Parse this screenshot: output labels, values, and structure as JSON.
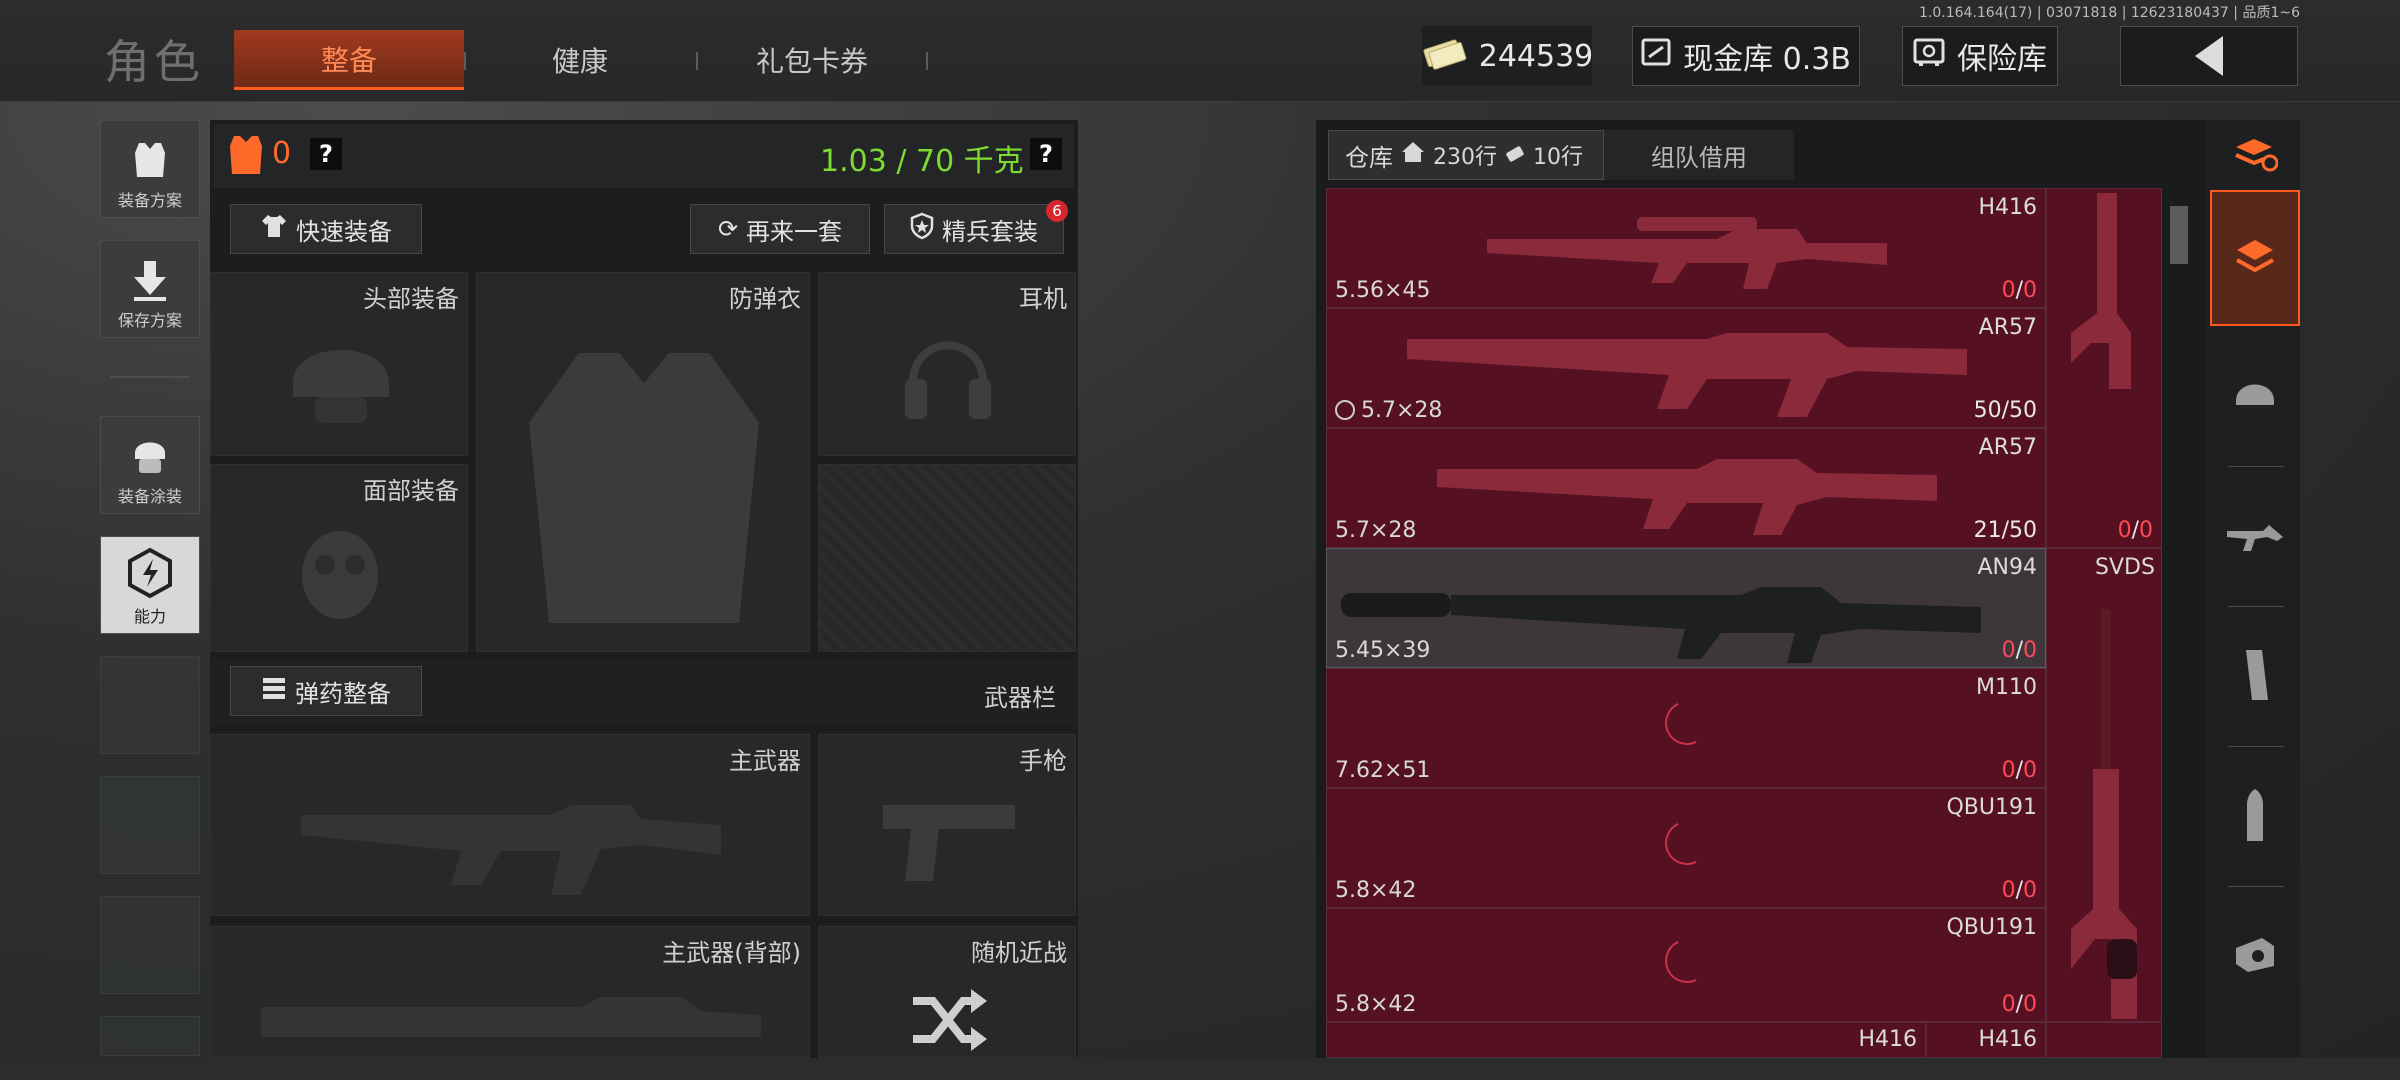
{
  "version": "1.0.164.164(17) | 03071818 | 12623180437 | 品质1~6",
  "header": {
    "title": "角色",
    "tabs": [
      "整备",
      "健康",
      "礼包卡券"
    ],
    "money": "244539",
    "cash_vault": "现金库 0.3B",
    "safe": "保险库"
  },
  "sidebar": {
    "items": [
      "装备方案",
      "保存方案",
      "装备涂装",
      "能力"
    ]
  },
  "loadout": {
    "armor_count": "0",
    "weight": "1.03 / 70 千克",
    "quick_equip": "快速装备",
    "reroll": "再来一套",
    "elite_set": "精兵套装",
    "elite_badge": "6",
    "slots": {
      "head": "头部装备",
      "vest": "防弹衣",
      "headset": "耳机",
      "face": "面部装备",
      "primary": "主武器",
      "pistol": "手枪",
      "primary_back": "主武器(背部)",
      "melee": "随机近战"
    },
    "ammo_equip": "弹药整备",
    "weapon_bar": "武器栏"
  },
  "warehouse": {
    "tab_label": "仓库",
    "rows_a": "230行",
    "rows_b": "10行",
    "team_borrow": "组队借用",
    "items": [
      {
        "name": "H416",
        "caliber": "5.56×45",
        "count_a": "0",
        "count_b": "0",
        "red": true
      },
      {
        "name": "AR57",
        "caliber": "5.7×28",
        "count_a": "50",
        "count_b": "50",
        "red": false
      },
      {
        "name": "AR57",
        "caliber": "5.7×28",
        "count_a": "21",
        "count_b": "50",
        "red": false
      },
      {
        "name": "AN94",
        "caliber": "5.45×39",
        "count_a": "0",
        "count_b": "0",
        "red": true
      },
      {
        "name": "M110",
        "caliber": "7.62×51",
        "count_a": "0",
        "count_b": "0",
        "red": true
      },
      {
        "name": "QBU191",
        "caliber": "5.8×42",
        "count_a": "0",
        "count_b": "0",
        "red": true
      },
      {
        "name": "QBU191",
        "caliber": "5.8×42",
        "count_a": "0",
        "count_b": "0",
        "red": true
      }
    ],
    "side_items": [
      {
        "name": "",
        "count_a": "0",
        "count_b": "0"
      },
      {
        "name": "SVDS"
      }
    ],
    "bottom_labels": [
      "H416",
      "H416"
    ]
  },
  "colors": {
    "accent": "#ff5a1f",
    "weight_green": "#7ddc2e",
    "red_cell": "#7a1e34",
    "count_red": "#ff4a55"
  }
}
